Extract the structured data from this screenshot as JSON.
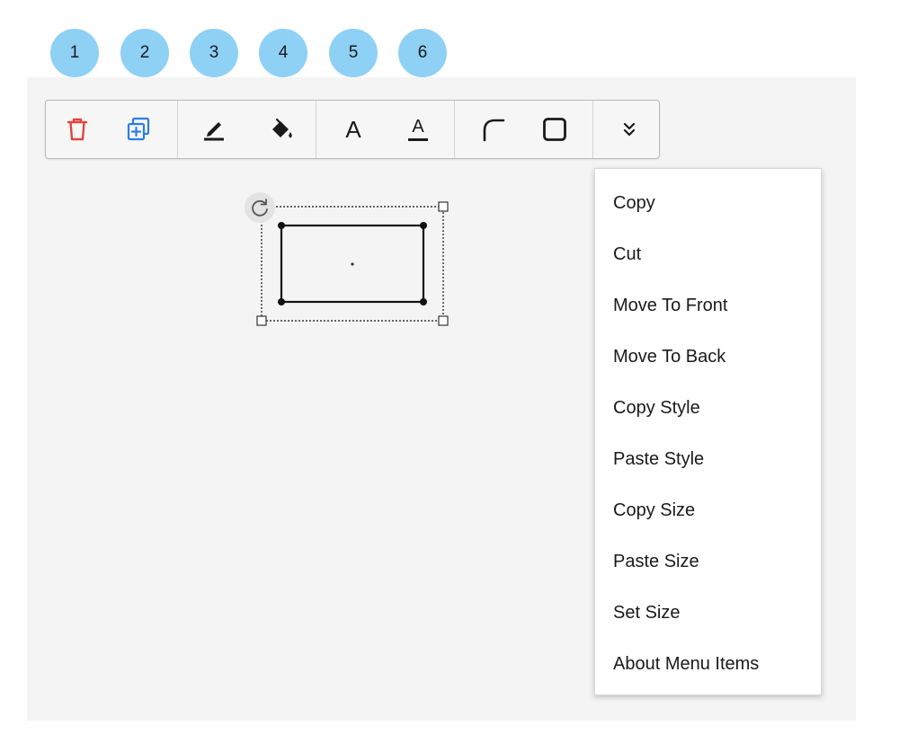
{
  "callouts": [
    "1",
    "2",
    "3",
    "4",
    "5",
    "6"
  ],
  "colors": {
    "callout_bg": "#8fd0f5",
    "delete_icon": "#e0463e",
    "duplicate_icon": "#2d7ce6",
    "canvas_bg": "#f4f4f4"
  },
  "toolbar": {
    "buttons": [
      {
        "name": "delete",
        "icon": "trash-icon"
      },
      {
        "name": "duplicate",
        "icon": "duplicate-icon"
      },
      {
        "name": "line-color",
        "icon": "pen-icon"
      },
      {
        "name": "fill-color",
        "icon": "paint-bucket-icon"
      },
      {
        "name": "font",
        "label": "A",
        "icon": "font-icon"
      },
      {
        "name": "font-color",
        "label": "A",
        "icon": "font-color-icon"
      },
      {
        "name": "corner-radius",
        "icon": "rounded-corner-icon"
      },
      {
        "name": "border",
        "icon": "square-border-icon"
      },
      {
        "name": "more",
        "icon": "chevron-double-down-icon"
      }
    ]
  },
  "context_menu": {
    "items": [
      "Copy",
      "Cut",
      "Move To Front",
      "Move To Back",
      "Copy Style",
      "Paste Style",
      "Copy Size",
      "Paste Size",
      "Set Size",
      "About Menu Items"
    ]
  }
}
